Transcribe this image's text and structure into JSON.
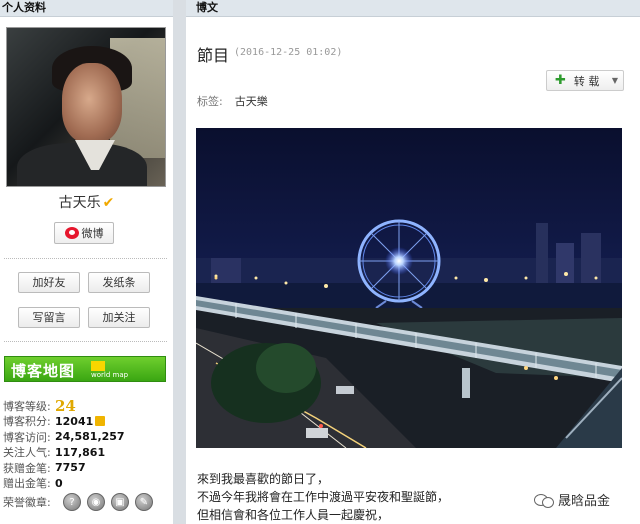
{
  "left_panel": {
    "header": "个人资料",
    "username": "古天乐",
    "verified_mark": "✔",
    "weibo_button": "微博",
    "buttons": {
      "add_friend": "加好友",
      "send_note": "发纸条",
      "write_message": "写留言",
      "follow": "加关注"
    },
    "blog_map": {
      "title": "博客地图",
      "subtitle": "world map"
    },
    "stats": [
      {
        "label": "博客等级:",
        "value": "24"
      },
      {
        "label": "博客积分:",
        "value": "12041"
      },
      {
        "label": "博客访问:",
        "value": "24,581,257"
      },
      {
        "label": "关注人气:",
        "value": "117,861"
      },
      {
        "label": "获赠金笔:",
        "value": "7757"
      },
      {
        "label": "赠出金笔:",
        "value": "0"
      },
      {
        "label": "荣誉徽章:",
        "value": ""
      }
    ]
  },
  "right_panel": {
    "header": "博文",
    "title": "節目",
    "date": "(2016-12-25 01:02)",
    "repost_button": "转 载",
    "tags_label": "标签:",
    "tags_value": "古天樂",
    "body_lines": [
      "來到我最喜歡的節日了，",
      "不過今年我將會在工作中渡過平安夜和聖誕節，",
      "但相信會和各位工作人員一起慶祝，"
    ],
    "watermark": "晟晗品金"
  },
  "colors": {
    "accent_green": "#3aa612",
    "level_gold": "#e0a800",
    "weibo_red": "#e6162d"
  }
}
